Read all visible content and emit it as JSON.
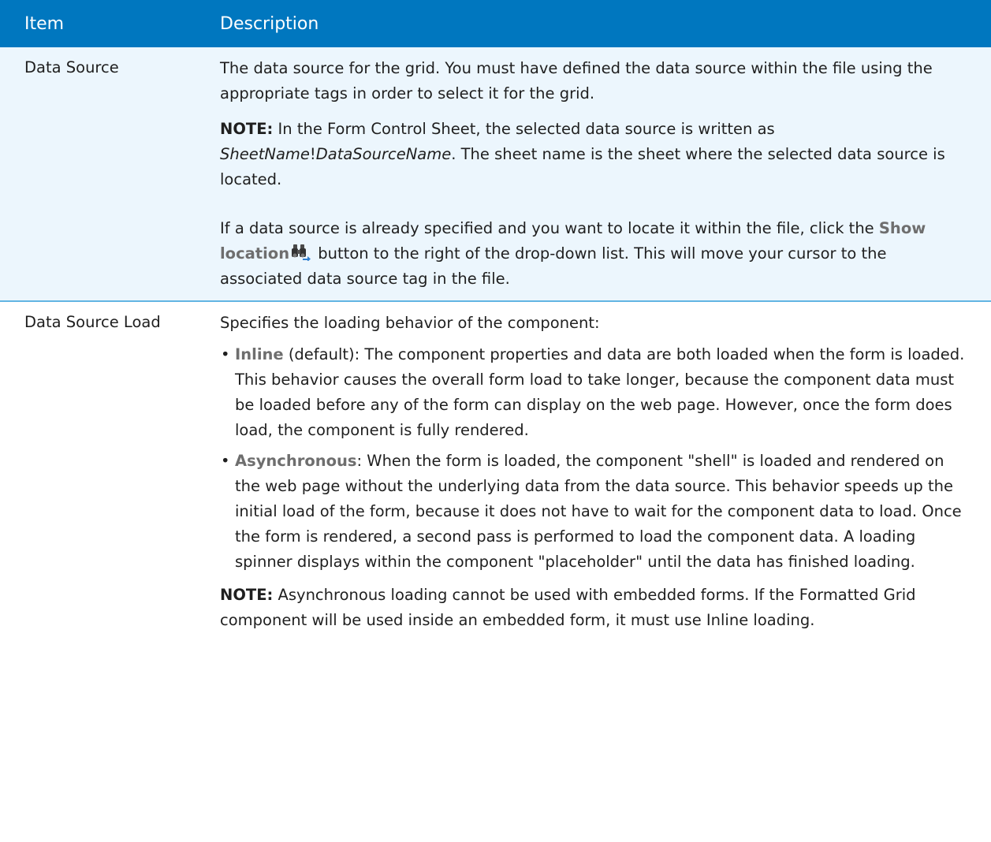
{
  "table": {
    "header": {
      "item": "Item",
      "description": "Description"
    },
    "rows": [
      {
        "item": "Data Source",
        "p1": "The data source for the grid. You must have defined the data source within the file using the appropriate tags in order to select it for the grid.",
        "note_label": "NOTE:",
        "note_text_1": " In the Form Control Sheet, the selected data source is written as ",
        "note_italic_1": "SheetName",
        "note_bang": "!",
        "note_italic_2": "DataSourceName",
        "note_text_2": ". The sheet name is the sheet where the selected data source is located.",
        "p3_text_1": "If a data source is already specified and you want to locate it within the file, click the ",
        "p3_button_label": "Show location",
        "p3_icon": "binoculars-icon",
        "p3_text_2": " button to the right of the drop-down list. This will move your cursor to the associated data source tag in the file."
      },
      {
        "item": "Data Source Load",
        "intro": "Specifies the loading behavior of the component:",
        "bullets": [
          {
            "term": "Inline",
            "text": " (default): The component properties and data are both loaded when the form is loaded. This behavior causes the overall form load to take longer, because the component data must be loaded before any of the form can display on the web page. However, once the form does load, the component is fully rendered."
          },
          {
            "term": "Asynchronous",
            "text": ": When the form is loaded, the component \"shell\" is loaded and rendered on the web page without the underlying data from the data source. This behavior speeds up the initial load of the form, because it does not have to wait for the component data to load. Once the form is rendered, a second pass is performed to load the component data. A loading spinner displays within the component \"placeholder\" until the data has finished loading."
          }
        ],
        "note_label": "NOTE:",
        "note_text": " Asynchronous loading cannot be used with embedded forms. If the Formatted Grid component will be used inside an embedded form, it must use Inline loading."
      }
    ]
  },
  "colors": {
    "header_bg": "#0077bf",
    "row1_bg": "#ecf6fd",
    "divider": "#62b5e3"
  }
}
